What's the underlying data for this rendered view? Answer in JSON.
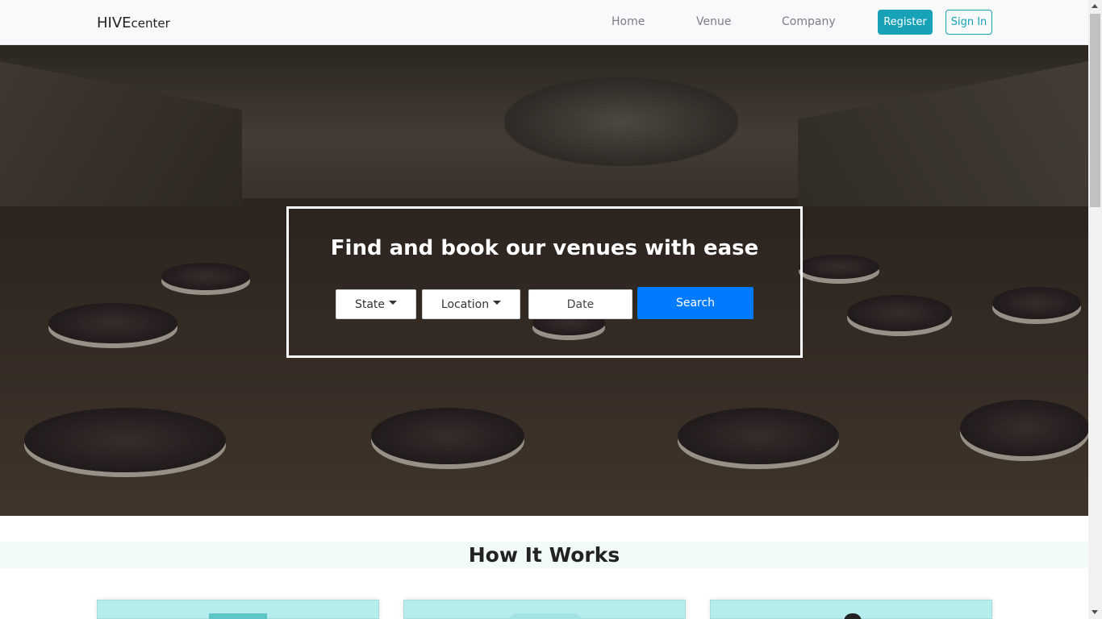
{
  "navbar": {
    "brand_main": "HIVE",
    "brand_small": "center",
    "links": [
      "Home",
      "Venue",
      "Company"
    ],
    "register_label": "Register",
    "signin_label": "Sign In"
  },
  "hero": {
    "title": "Find and book our venues with ease",
    "state_label": "State",
    "location_label": "Location",
    "date_placeholder": "Date",
    "search_label": "Search"
  },
  "how_it_works": {
    "title": "How It Works"
  },
  "colors": {
    "info": "#17a2b8",
    "primary": "#007bff",
    "card_bg": "#b6ecec"
  }
}
